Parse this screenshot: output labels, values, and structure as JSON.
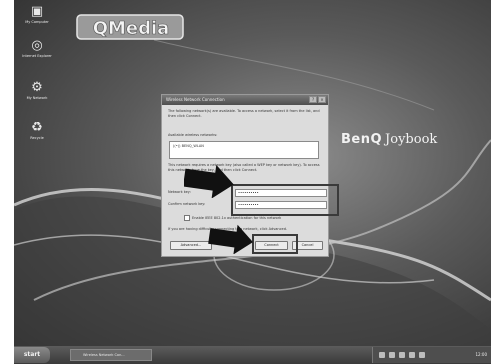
{
  "desktop": {
    "icons": [
      {
        "label": "My Computer",
        "glyph": "▣",
        "icon": "computer-icon"
      },
      {
        "label": "Internet Explorer",
        "glyph": "◎",
        "icon": "browser-icon"
      },
      {
        "label": "My Network",
        "glyph": "⚙",
        "icon": "network-icon"
      },
      {
        "label": "Recycle",
        "glyph": "♻",
        "icon": "recycle-icon"
      }
    ],
    "logo_text": "QMedia",
    "brand": {
      "name": "BenQ",
      "product": "Joybook"
    }
  },
  "dialog": {
    "title": "Wireless Network Connection",
    "intro": "The following network(s) are available. To access a network, select it from the list, and then click Connect.",
    "available_label": "Available wireless networks:",
    "networks": [
      "BENQ_WLAN"
    ],
    "warning": "This network requires a network key (also called a WEP key or network key). To access this network, type the key, and then click Connect.",
    "network_key_label": "Network key:",
    "network_key_value": "••••••••••",
    "confirm_key_label": "Confirm network key:",
    "confirm_key_value": "••••••••••",
    "checkbox_label": "Enable IEEE 802.1x authentication for this network",
    "trouble_text": "If you are having difficulty connecting to a network, click Advanced.",
    "buttons": {
      "advanced": "Advanced...",
      "connect": "Connect",
      "cancel": "Cancel"
    }
  },
  "taskbar": {
    "start": "start",
    "task": "Wireless Network Con...",
    "clock": "12:00"
  },
  "colors": {
    "highlight": "#3a3a3a",
    "arrow": "#111111"
  }
}
